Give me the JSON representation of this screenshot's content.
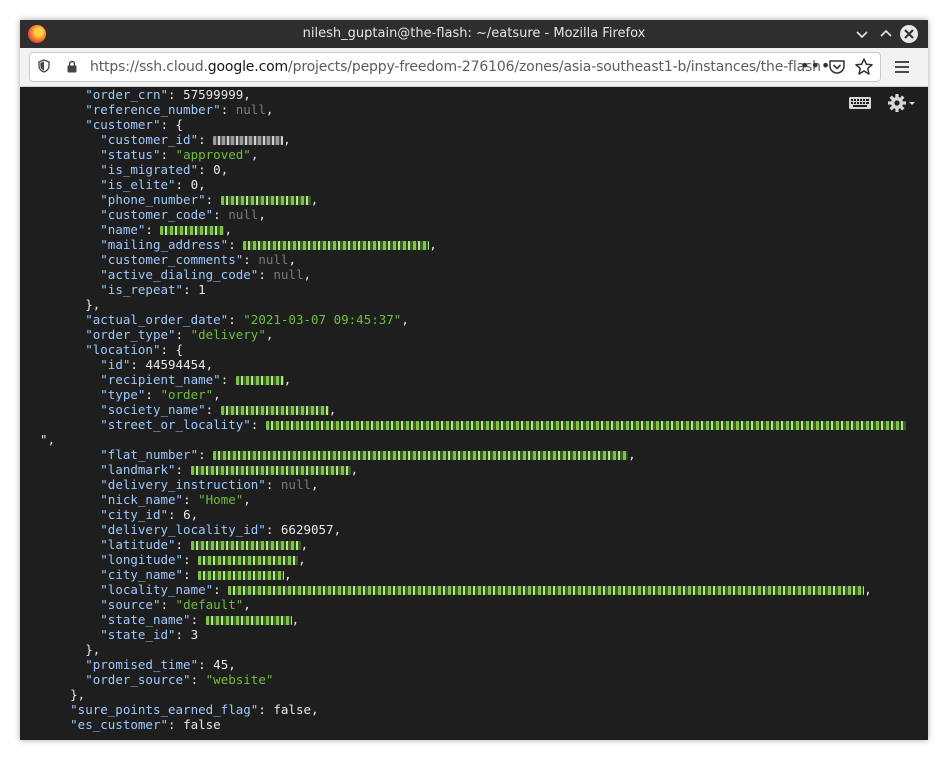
{
  "window": {
    "title": "nilesh_guptain@the-flash: ~/eatsure - Mozilla Firefox"
  },
  "toolbar": {
    "url_prefix": "https://ssh.cloud.",
    "url_domain": "google.com",
    "url_path": "/projects/peppy-freedom-276106/zones/asia-southeast1-b/instances/the-flash",
    "more_label": "•••"
  },
  "terminal": {
    "lines": [
      "order_crn",
      "57599999",
      "reference_number",
      "null",
      "customer",
      "customer_id",
      "status",
      "approved",
      "is_migrated",
      "0",
      "is_elite",
      "0",
      "phone_number",
      "customer_code",
      "null",
      "name",
      "mailing_address",
      "customer_comments",
      "null",
      "active_dialing_code",
      "null",
      "is_repeat",
      "1",
      "actual_order_date",
      "2021-03-07 09:45:37",
      "order_type",
      "delivery",
      "location",
      "id",
      "44594454",
      "recipient_name",
      "type",
      "order",
      "society_name",
      "street_or_locality",
      "flat_number",
      "landmark",
      "delivery_instruction",
      "null",
      "nick_name",
      "Home",
      "city_id",
      "6",
      "delivery_locality_id",
      "6629057",
      "latitude",
      "longitude",
      "city_name",
      "locality_name",
      "source",
      "default",
      "state_name",
      "state_id",
      "3",
      "promised_time",
      "45",
      "order_source",
      "website",
      "sure_points_earned_flag",
      "false",
      "es_customer",
      "false"
    ]
  },
  "json": {
    "order_crn_key": "\"order_crn\"",
    "order_crn_val": "57599999",
    "reference_number_key": "\"reference_number\"",
    "reference_number_val": "null",
    "customer_key": "\"customer\"",
    "customer_id_key": "\"customer_id\"",
    "status_key": "\"status\"",
    "status_val": "\"approved\"",
    "is_migrated_key": "\"is_migrated\"",
    "is_migrated_val": "0",
    "is_elite_key": "\"is_elite\"",
    "is_elite_val": "0",
    "phone_number_key": "\"phone_number\"",
    "customer_code_key": "\"customer_code\"",
    "customer_code_val": "null",
    "name_key": "\"name\"",
    "mailing_address_key": "\"mailing_address\"",
    "customer_comments_key": "\"customer_comments\"",
    "customer_comments_val": "null",
    "active_dialing_code_key": "\"active_dialing_code\"",
    "active_dialing_code_val": "null",
    "is_repeat_key": "\"is_repeat\"",
    "is_repeat_val": "1",
    "actual_order_date_key": "\"actual_order_date\"",
    "actual_order_date_val": "\"2021-03-07 09:45:37\"",
    "order_type_key": "\"order_type\"",
    "order_type_val": "\"delivery\"",
    "location_key": "\"location\"",
    "id_key": "\"id\"",
    "id_val": "44594454",
    "recipient_name_key": "\"recipient_name\"",
    "type_key": "\"type\"",
    "type_val": "\"order\"",
    "society_name_key": "\"society_name\"",
    "street_or_locality_key": "\"street_or_locality\"",
    "flat_number_key": "\"flat_number\"",
    "landmark_key": "\"landmark\"",
    "delivery_instruction_key": "\"delivery_instruction\"",
    "delivery_instruction_val": "null",
    "nick_name_key": "\"nick_name\"",
    "nick_name_val": "\"Home\"",
    "city_id_key": "\"city_id\"",
    "city_id_val": "6",
    "delivery_locality_id_key": "\"delivery_locality_id\"",
    "delivery_locality_id_val": "6629057",
    "latitude_key": "\"latitude\"",
    "longitude_key": "\"longitude\"",
    "city_name_key": "\"city_name\"",
    "locality_name_key": "\"locality_name\"",
    "source_key": "\"source\"",
    "source_val": "\"default\"",
    "state_name_key": "\"state_name\"",
    "state_id_key": "\"state_id\"",
    "state_id_val": "3",
    "promised_time_key": "\"promised_time\"",
    "promised_time_val": "45",
    "order_source_key": "\"order_source\"",
    "order_source_val": "\"website\"",
    "sure_points_earned_flag_key": "\"sure_points_earned_flag\"",
    "sure_points_earned_flag_val": "false",
    "es_customer_key": "\"es_customer\"",
    "es_customer_val": "false"
  },
  "colors": {
    "key": "#9ec9ff",
    "string": "#6fbf3a",
    "null": "#7a7a7a",
    "background": "#1e1e1e"
  },
  "icons": [
    "firefox-logo-icon",
    "shield-icon",
    "lock-icon",
    "pocket-icon",
    "star-icon",
    "hamburger-menu-icon",
    "keyboard-icon",
    "gear-icon"
  ]
}
